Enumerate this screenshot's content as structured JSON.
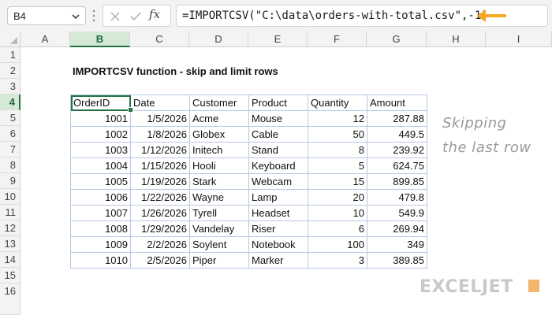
{
  "formula_bar": {
    "name_box": "B4",
    "fx_label": "fx",
    "formula": "=IMPORTCSV(\"C:\\data\\orders-with-total.csv\",-1)",
    "arrow_color": "#f5a623"
  },
  "columns": [
    "A",
    "B",
    "C",
    "D",
    "E",
    "F",
    "G",
    "H",
    "I"
  ],
  "rows": [
    "1",
    "2",
    "3",
    "4",
    "5",
    "6",
    "7",
    "8",
    "9",
    "10",
    "11",
    "12",
    "13",
    "14",
    "15",
    "16"
  ],
  "sheet": {
    "title": "IMPORTCSV function - skip and limit rows",
    "headers": [
      "OrderID",
      "Date",
      "Customer",
      "Product",
      "Quantity",
      "Amount"
    ],
    "data": [
      [
        "1001",
        "1/5/2026",
        "Acme",
        "Mouse",
        "12",
        "287.88"
      ],
      [
        "1002",
        "1/8/2026",
        "Globex",
        "Cable",
        "50",
        "449.5"
      ],
      [
        "1003",
        "1/12/2026",
        "Initech",
        "Stand",
        "8",
        "239.92"
      ],
      [
        "1004",
        "1/15/2026",
        "Hooli",
        "Keyboard",
        "5",
        "624.75"
      ],
      [
        "1005",
        "1/19/2026",
        "Stark",
        "Webcam",
        "15",
        "899.85"
      ],
      [
        "1006",
        "1/22/2026",
        "Wayne",
        "Lamp",
        "20",
        "479.8"
      ],
      [
        "1007",
        "1/26/2026",
        "Tyrell",
        "Headset",
        "10",
        "549.9"
      ],
      [
        "1008",
        "1/29/2026",
        "Vandelay",
        "Riser",
        "6",
        "269.94"
      ],
      [
        "1009",
        "2/2/2026",
        "Soylent",
        "Notebook",
        "100",
        "349"
      ],
      [
        "1010",
        "2/5/2026",
        "Piper",
        "Marker",
        "3",
        "389.85"
      ]
    ]
  },
  "note": {
    "line1": "Skipping",
    "line2": "the last row"
  },
  "logo": {
    "text": "EXCELJET"
  },
  "colors": {
    "accent": "#217346",
    "table_border": "#b7c7e6",
    "logo_mark": "#f2b66d"
  }
}
